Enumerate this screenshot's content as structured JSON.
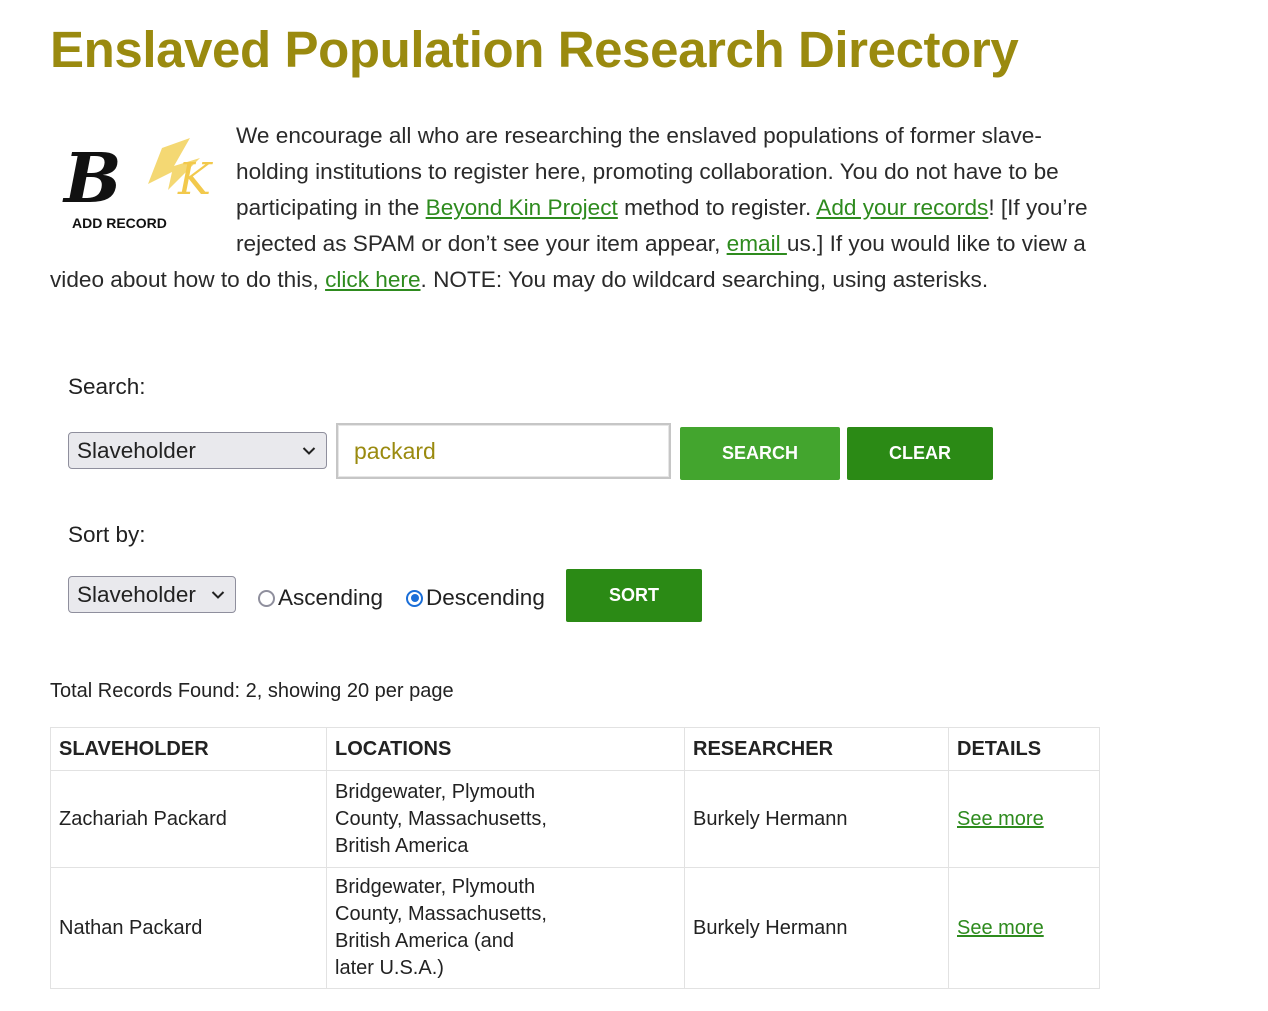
{
  "page": {
    "title": "Enslaved Population Research Directory"
  },
  "logo": {
    "text": "ADD RECORD"
  },
  "intro": {
    "p1": "We encourage all who are researching the enslaved populations of former slave-holding institutions to register here, promoting collaboration. You do not have to be participating in the ",
    "link_beyond_kin": "Beyond Kin Project",
    "p2": " method to register. ",
    "link_add_records": "Add your records",
    "p3": "! [If you’re rejected as SPAM or don’t see your item appear, ",
    "link_email": "email ",
    "p4": "us.] If you would like to view a video about how to do this, ",
    "link_click_here": "click here",
    "p5": ". NOTE: You may do wildcard searching, using asterisks."
  },
  "search": {
    "label": "Search:",
    "field_selected": "Slaveholder",
    "query_value": "packard",
    "search_button": "SEARCH",
    "clear_button": "CLEAR"
  },
  "sort": {
    "label": "Sort by:",
    "field_selected": "Slaveholder",
    "ascending_label": "Ascending",
    "descending_label": "Descending",
    "selected_order": "Descending",
    "sort_button": "SORT"
  },
  "results": {
    "summary": "Total Records Found: 2, showing 20 per page",
    "columns": [
      "SLAVEHOLDER",
      "LOCATIONS",
      "RESEARCHER",
      "DETAILS"
    ],
    "rows": [
      {
        "slaveholder": "Zachariah Packard",
        "locations": [
          "Bridgewater, Plymouth",
          "County, Massachusetts,",
          "British America"
        ],
        "researcher": "Burkely Hermann",
        "details": "See more"
      },
      {
        "slaveholder": "Nathan Packard",
        "locations": [
          "Bridgewater, Plymouth",
          "County, Massachusetts,",
          "British America (and",
          "later U.S.A.)"
        ],
        "researcher": "Burkely Hermann",
        "details": "See more"
      }
    ]
  },
  "colors": {
    "title": "#9a8a0f",
    "link": "#2e8b1e",
    "search_button": "#43a52e",
    "clear_button": "#2b8a15",
    "sort_button": "#2b8a15",
    "radio_checked": "#1a6ed8",
    "logo_gold": "#f2d15a"
  },
  "icons": {
    "select_chevron": "chevron-down-icon",
    "radio": "radio-button"
  }
}
